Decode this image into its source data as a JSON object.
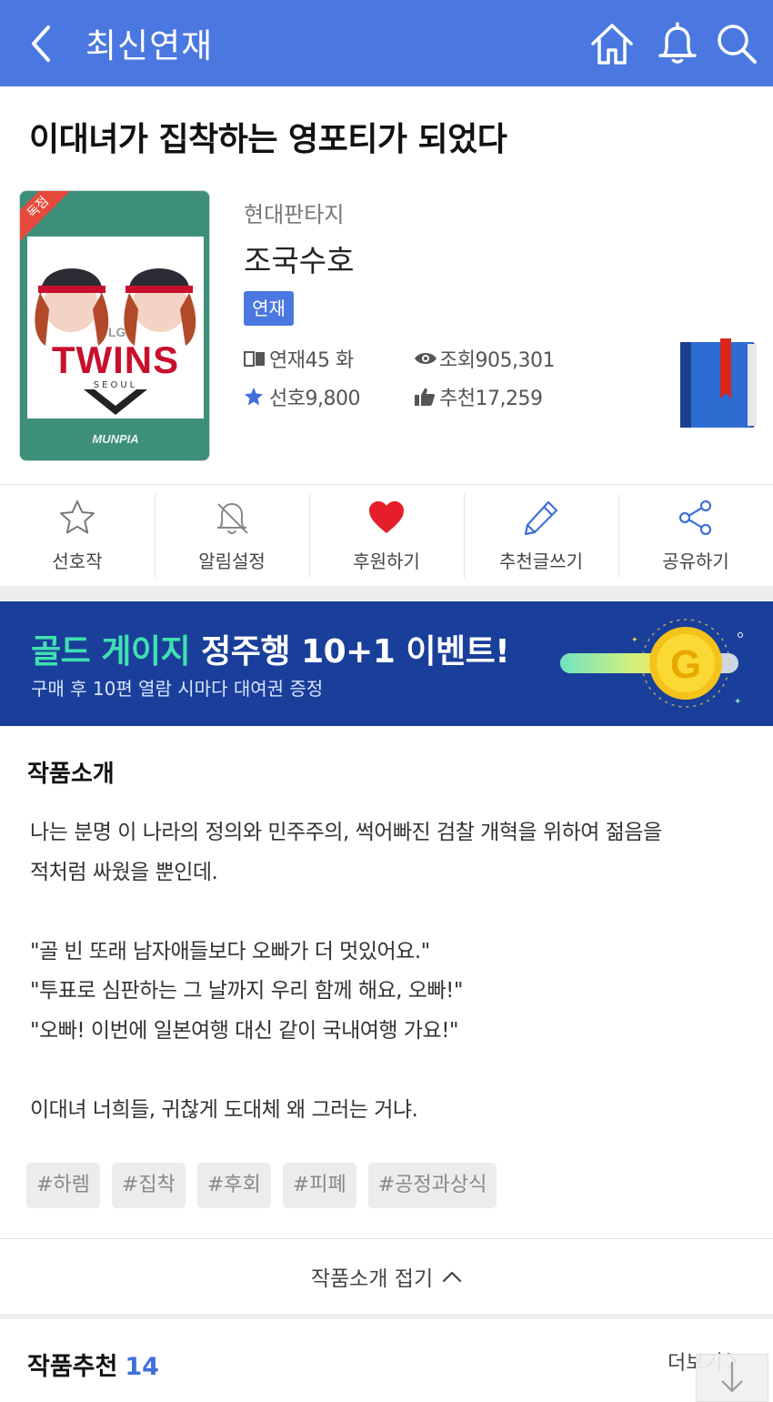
{
  "header": {
    "title": "최신연재",
    "bg_color": "#4a78e0",
    "icons": [
      "back-arrow-icon",
      "home-icon",
      "bell-icon",
      "search-icon"
    ]
  },
  "novel": {
    "title": "이대녀가 집착하는 영포티가 되었다",
    "cover": {
      "badge": "독점",
      "logo_text": "TWINS",
      "logo_sub": "SEOUL",
      "brand": "MUNPIA"
    },
    "genre": "현대판타지",
    "author": "조국수호",
    "status": "연재",
    "stats": {
      "episodes": "연재45 화",
      "views": "조회905,301",
      "favorites": "선호9,800",
      "recommends": "추천17,259"
    }
  },
  "actions": [
    {
      "label": "선호작",
      "icon": "star-outline-icon"
    },
    {
      "label": "알림설정",
      "icon": "bell-off-icon"
    },
    {
      "label": "후원하기",
      "icon": "heart-icon"
    },
    {
      "label": "추천글쓰기",
      "icon": "pencil-icon"
    },
    {
      "label": "공유하기",
      "icon": "share-icon"
    }
  ],
  "banner": {
    "highlight": "골드 게이지",
    "headline": " 정주행 10+1 이벤트!",
    "sub": "구매 후 10편 열람 시마다 대여권 증정",
    "gauge_letter": "G"
  },
  "intro": {
    "title": "작품소개",
    "lines": [
      "나는 분명 이 나라의 정의와 민주주의, 썩어빠진 검찰 개혁을 위하여 젊음을",
      "적처럼 싸웠을 뿐인데.",
      "",
      "\"골 빈 또래 남자애들보다 오빠가 더 멋있어요.\"",
      "\"투표로 심판하는 그 날까지 우리 함께 해요, 오빠!\"",
      "\"오빠! 이번에 일본여행 대신 같이 국내여행 가요!\"",
      "",
      "이대녀 너희들, 귀찮게 도대체 왜 그러는 거냐."
    ],
    "tags": [
      "#하렘",
      "#집착",
      "#후회",
      "#피폐",
      "#공정과상식"
    ],
    "fold_label": "작품소개 접기"
  },
  "recommend": {
    "title": "작품추천",
    "count": "14",
    "more_label": "더보기"
  }
}
